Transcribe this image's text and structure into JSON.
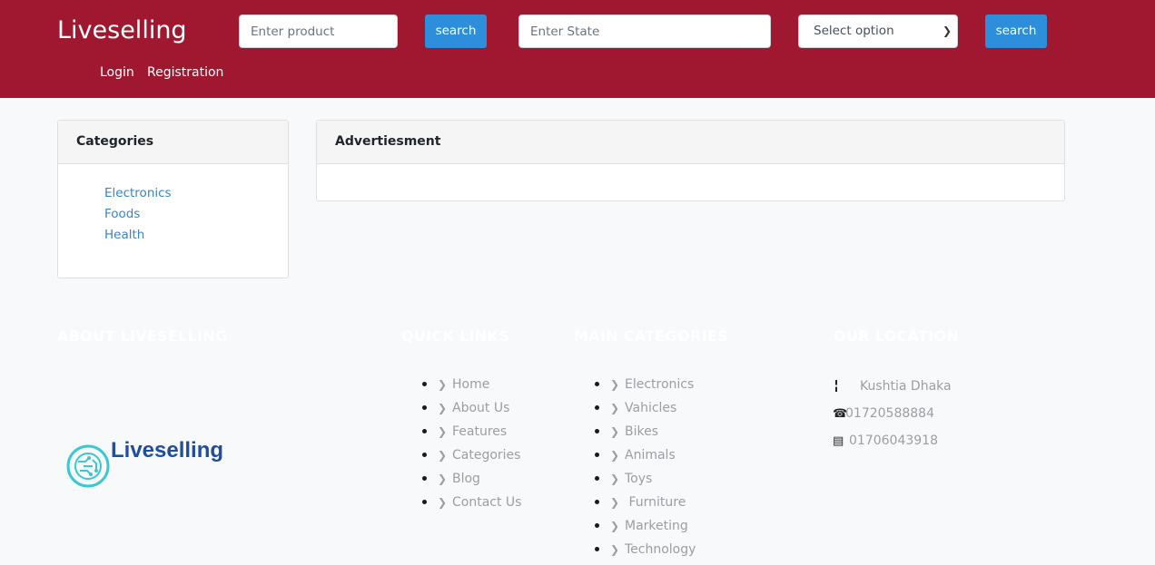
{
  "navbar": {
    "brand": "Liveselling",
    "product_placeholder": "Enter product",
    "search_label_1": "search",
    "state_placeholder": "Enter State",
    "select_value": "Select option",
    "search_label_2": "search",
    "login": "Login",
    "registration": "Registration"
  },
  "sidebar": {
    "title": "Categories",
    "items": [
      "Electronics",
      "Foods",
      "Health"
    ]
  },
  "main": {
    "title": "Advertiesment"
  },
  "footer": {
    "about_title": "ABOUT LIVESELLING",
    "logo_text": "Liveselling",
    "quick_links_title": "QUICK LINKS",
    "quick_links": [
      "Home",
      "About Us",
      "Features",
      "Categories",
      "Blog",
      "Contact Us"
    ],
    "main_categories_title": "MAIN CATEGORIES",
    "main_categories": [
      "Electronics",
      "Vahicles",
      "Bikes",
      "Animals",
      "Toys",
      " Furniture",
      "Marketing",
      "Technology"
    ],
    "location_title": "OUR LOCATION",
    "address": "Kushtia Dhaka",
    "phone": "01720588884",
    "fax": "01706043918"
  },
  "colors": {
    "navbar_bg": "#a01830",
    "button_bg": "#2d8fdc",
    "link": "#3b84c4",
    "logo_blue": "#1f4e9c",
    "logo_cyan": "#3cc6d6"
  }
}
